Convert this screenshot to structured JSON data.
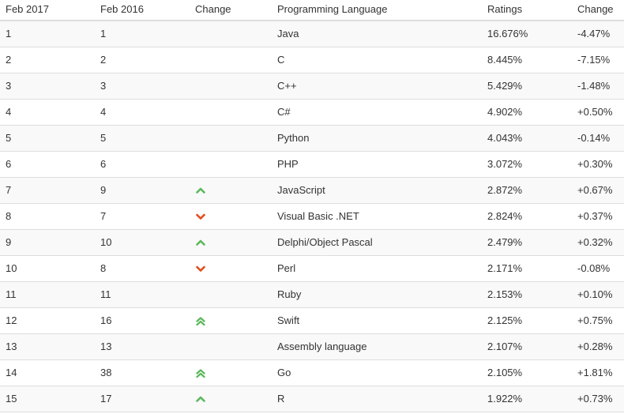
{
  "headers": {
    "feb2017": "Feb 2017",
    "feb2016": "Feb 2016",
    "change": "Change",
    "language": "Programming Language",
    "ratings": "Ratings",
    "rating_change": "Change"
  },
  "trend_colors": {
    "up": "#5cb85c",
    "down": "#e14d1c"
  },
  "rows": [
    {
      "feb2017": "1",
      "feb2016": "1",
      "trend": "none",
      "language": "Java",
      "rating": "16.676%",
      "change": "-4.47%"
    },
    {
      "feb2017": "2",
      "feb2016": "2",
      "trend": "none",
      "language": "C",
      "rating": "8.445%",
      "change": "-7.15%"
    },
    {
      "feb2017": "3",
      "feb2016": "3",
      "trend": "none",
      "language": "C++",
      "rating": "5.429%",
      "change": "-1.48%"
    },
    {
      "feb2017": "4",
      "feb2016": "4",
      "trend": "none",
      "language": "C#",
      "rating": "4.902%",
      "change": "+0.50%"
    },
    {
      "feb2017": "5",
      "feb2016": "5",
      "trend": "none",
      "language": "Python",
      "rating": "4.043%",
      "change": "-0.14%"
    },
    {
      "feb2017": "6",
      "feb2016": "6",
      "trend": "none",
      "language": "PHP",
      "rating": "3.072%",
      "change": "+0.30%"
    },
    {
      "feb2017": "7",
      "feb2016": "9",
      "trend": "up",
      "language": "JavaScript",
      "rating": "2.872%",
      "change": "+0.67%"
    },
    {
      "feb2017": "8",
      "feb2016": "7",
      "trend": "down",
      "language": "Visual Basic .NET",
      "rating": "2.824%",
      "change": "+0.37%"
    },
    {
      "feb2017": "9",
      "feb2016": "10",
      "trend": "up",
      "language": "Delphi/Object Pascal",
      "rating": "2.479%",
      "change": "+0.32%"
    },
    {
      "feb2017": "10",
      "feb2016": "8",
      "trend": "down",
      "language": "Perl",
      "rating": "2.171%",
      "change": "-0.08%"
    },
    {
      "feb2017": "11",
      "feb2016": "11",
      "trend": "none",
      "language": "Ruby",
      "rating": "2.153%",
      "change": "+0.10%"
    },
    {
      "feb2017": "12",
      "feb2016": "16",
      "trend": "double-up",
      "language": "Swift",
      "rating": "2.125%",
      "change": "+0.75%"
    },
    {
      "feb2017": "13",
      "feb2016": "13",
      "trend": "none",
      "language": "Assembly language",
      "rating": "2.107%",
      "change": "+0.28%"
    },
    {
      "feb2017": "14",
      "feb2016": "38",
      "trend": "double-up",
      "language": "Go",
      "rating": "2.105%",
      "change": "+1.81%"
    },
    {
      "feb2017": "15",
      "feb2016": "17",
      "trend": "up",
      "language": "R",
      "rating": "1.922%",
      "change": "+0.73%"
    }
  ]
}
